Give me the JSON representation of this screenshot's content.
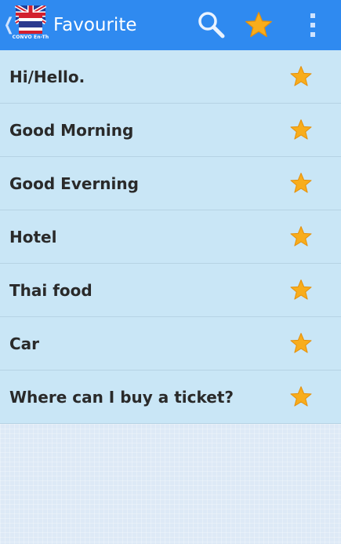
{
  "app": {
    "title": "Favourite",
    "logo_text": "CONVO En-Th"
  },
  "toolbar": {
    "search_icon": "search-icon",
    "favourite_icon": "star-icon",
    "overflow_icon": "overflow-menu-icon"
  },
  "colors": {
    "action_bar": "#2f8af0",
    "list_bg": "#c9e6f6",
    "page_bg": "#dde9f6",
    "star": "#f7a81c",
    "text": "#2a2a2a"
  },
  "favourites": [
    {
      "label": "Hi/Hello.",
      "icon": "star-icon"
    },
    {
      "label": "Good Morning",
      "icon": "star-icon"
    },
    {
      "label": "Good Everning",
      "icon": "star-icon"
    },
    {
      "label": "Hotel",
      "icon": "star-icon"
    },
    {
      "label": "Thai food",
      "icon": "star-icon"
    },
    {
      "label": "Car",
      "icon": "star-icon"
    },
    {
      "label": "Where can I buy a ticket?",
      "icon": "star-icon"
    }
  ]
}
